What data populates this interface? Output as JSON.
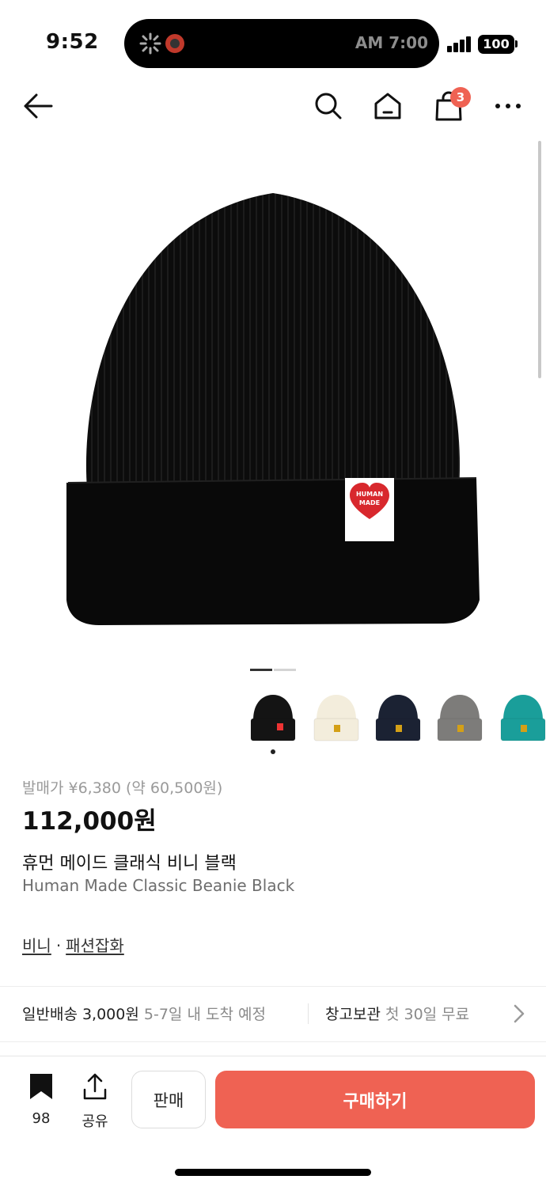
{
  "status_bar": {
    "time": "9:52",
    "island_text": "AM 7:00",
    "battery": "100"
  },
  "nav": {
    "cart_count": "3",
    "icons": [
      "back-arrow-icon",
      "search-icon",
      "home-icon",
      "shopping-bag-icon",
      "more-icon"
    ]
  },
  "product": {
    "image_label_line1": "HUMAN",
    "image_label_line2": "MADE",
    "release_price": "발매가 ¥6,380 (약 60,500원)",
    "price": "112,000원",
    "name_ko": "휴먼 메이드 클래식 비니 블랙",
    "name_en": "Human Made Classic Beanie Black",
    "category_1": "비니",
    "category_separator": "·",
    "category_2": "패션잡화",
    "carousel_active_index": 1,
    "carousel_total": 2
  },
  "thumbnails": {
    "colors": [
      "#141414",
      "#f3eddc",
      "#1b2233",
      "#7d7c7a",
      "#1a9e9a"
    ],
    "selected_index": 0
  },
  "delivery": {
    "standard_label": "일반배송 3,000원",
    "standard_eta": "5-7일 내 도착 예정",
    "storage_label": "창고보관",
    "storage_desc": "첫 30일 무료"
  },
  "bottom_bar": {
    "bookmark_count": "98",
    "share_label": "공유",
    "sell_label": "판매",
    "buy_label": "구매하기",
    "accent_color": "#ef6253"
  }
}
